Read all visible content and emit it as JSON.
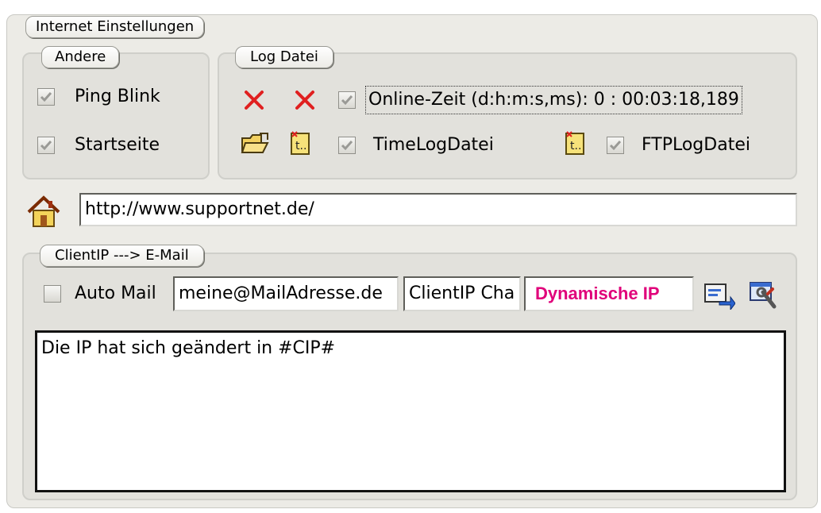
{
  "internet_group": {
    "title": "Internet Einstellungen"
  },
  "andere": {
    "title": "Andere",
    "ping_blink": {
      "label": "Ping Blink",
      "checked": true
    },
    "startseite": {
      "label": "Startseite",
      "checked": true
    }
  },
  "log_datei": {
    "title": "Log Datei",
    "online_zeit": {
      "label": "Online-Zeit (d:h:m:s,ms): 0 : 00:03:18,189",
      "checked": true
    },
    "time_log": {
      "label": "TimeLogDatei",
      "checked": true
    },
    "ftp_log": {
      "label": "FTPLogDatei",
      "checked": true
    }
  },
  "homepage": {
    "url": "http://www.supportnet.de/"
  },
  "client_ip": {
    "title": "ClientIP ---> E-Mail",
    "auto_mail": {
      "label": "Auto Mail",
      "checked": false
    },
    "email": "meine@MailAdresse.de",
    "subject": "ClientIP Cha",
    "mode": "Dynamische IP",
    "message": "Die IP hat sich geändert in #CIP#"
  },
  "colors": {
    "mode_text": "#e0007a",
    "delete_red": "#e02020"
  }
}
